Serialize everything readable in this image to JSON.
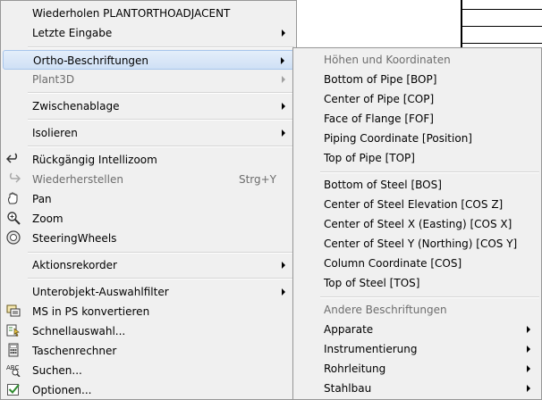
{
  "main_menu": {
    "repeat": "Wiederholen PLANTORTHOADJACENT",
    "last_input": "Letzte Eingabe",
    "ortho": "Ortho-Beschriftungen",
    "plant3d": "Plant3D",
    "clipboard": "Zwischenablage",
    "isolate": "Isolieren",
    "undo_zoom": "Rückgängig Intellizoom",
    "redo": "Wiederherstellen",
    "redo_shortcut": "Strg+Y",
    "pan": "Pan",
    "zoom": "Zoom",
    "steeringwheels": "SteeringWheels",
    "action_recorder": "Aktionsrekorder",
    "subobject_filter": "Unterobjekt-Auswahlfilter",
    "ms_ps": "MS in PS konvertieren",
    "quick_select": "Schnellauswahl...",
    "calculator": "Taschenrechner",
    "find": "Suchen...",
    "options": "Optionen..."
  },
  "sub_menu": {
    "header_heights": "Höhen und Koordinaten",
    "bop": "Bottom of Pipe [BOP]",
    "cop": "Center of Pipe [COP]",
    "fof": "Face of Flange [FOF]",
    "piping_coord": "Piping Coordinate [Position]",
    "top_pipe": "Top of Pipe [TOP]",
    "bos": "Bottom of Steel [BOS]",
    "cos_z": "Center of Steel Elevation [COS Z]",
    "cos_x": "Center of Steel X (Easting) [COS X]",
    "cos_y": "Center of Steel Y (Northing) [COS Y]",
    "column_coord": "Column Coordinate [COS]",
    "tos": "Top of Steel [TOS]",
    "header_other": "Andere Beschriftungen",
    "apparatus": "Apparate",
    "instrumentation": "Instrumentierung",
    "piping": "Rohrleitung",
    "steel": "Stahlbau"
  },
  "icons": {
    "undo": "undo-arrow-icon",
    "redo": "redo-arrow-icon",
    "pan": "pan-hand-icon",
    "zoom": "zoom-magnifier-icon",
    "steeringwheels": "steering-wheel-icon",
    "ms_ps": "ms-ps-convert-icon",
    "quick_select": "quick-select-icon",
    "calculator": "calculator-icon",
    "find": "find-text-icon",
    "options": "options-checkbox-icon"
  },
  "colors": {
    "menu_bg": "#f0f0f0",
    "highlight": "#cfe0f5",
    "disabled_text": "#6d6d6d"
  }
}
